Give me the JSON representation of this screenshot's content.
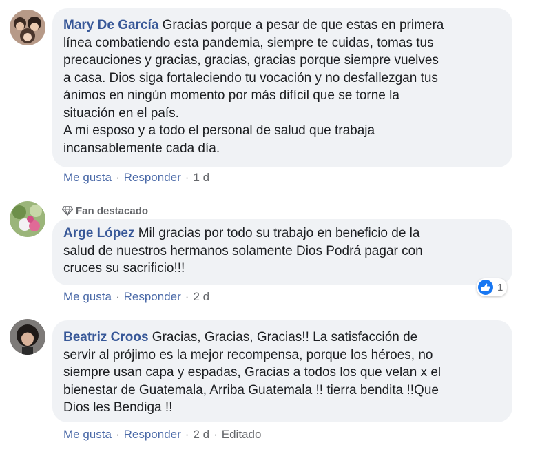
{
  "colors": {
    "name_link": "#385898",
    "bubble_bg": "#f0f2f5",
    "like_blue": "#1877f2",
    "meta_gray": "#65676b"
  },
  "comments": [
    {
      "author": "Mary De García",
      "badge": "",
      "text_lines": [
        " Gracias porque a pesar de que estas en primera",
        "línea combatiendo esta pandemia, siempre te cuidas, tomas tus",
        "precauciones y gracias, gracias, gracias porque siempre vuelves",
        "a casa. Dios siga fortaleciendo tu vocación y no desfallezgan tus",
        "ánimos en ningún momento por más difícil que se torne la",
        "situación en el país.",
        "A mi esposo y a todo el personal de salud que trabaja",
        "incansablemente cada día."
      ],
      "like_label": "Me gusta",
      "reply_label": "Responder",
      "time": "1 d",
      "edited": "",
      "reactions": ""
    },
    {
      "author": "Arge López",
      "badge": "Fan destacado",
      "text_lines": [
        " Mil gracias por todo su trabajo en beneficio de la",
        "salud de nuestros hermanos solamente Dios Podrá pagar con",
        "cruces su sacrificio!!!"
      ],
      "like_label": "Me gusta",
      "reply_label": "Responder",
      "time": "2 d",
      "edited": "",
      "reactions": "1"
    },
    {
      "author": "Beatriz Croos",
      "badge": "",
      "text_lines": [
        " Gracias, Gracias, Gracias!! La satisfacción de",
        "servir al prójimo es la mejor recompensa, porque los héroes, no",
        "siempre usan capa y espadas, Gracias a todos los que velan x el",
        "bienestar de Guatemala, Arriba Guatemala !! tierra bendita !!Que",
        "Dios les Bendiga !!"
      ],
      "like_label": "Me gusta",
      "reply_label": "Responder",
      "time": "2 d",
      "edited": "Editado",
      "reactions": ""
    }
  ]
}
